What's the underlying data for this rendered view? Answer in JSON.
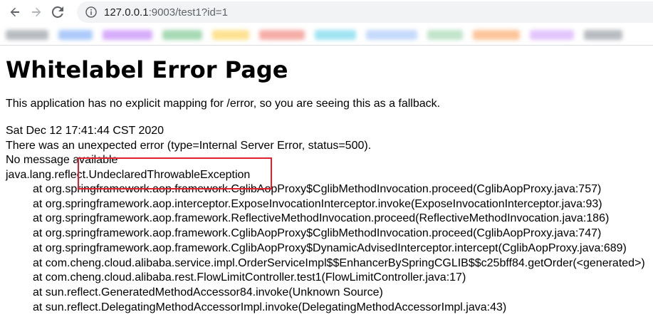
{
  "browser": {
    "url_host": "127.0.0.1",
    "url_rest": ":9003/test1?id=1",
    "icons": [
      "back-arrow-icon",
      "forward-arrow-icon",
      "reload-icon",
      "info-icon"
    ]
  },
  "bookmarks_colors": [
    "#9aa0a6",
    "#8ab4f8",
    "#c58af9",
    "#81c995",
    "#fdd663",
    "#f28b82",
    "#78d9ec",
    "#aecbfa",
    "#a8dab5",
    "#fcad70",
    "#d7aefb",
    "#9aa0a6"
  ],
  "page": {
    "title": "Whitelabel Error Page",
    "message": "This application has no explicit mapping for /error, so you are seeing this as a fallback.",
    "timestamp": "Sat Dec 12 17:41:44 CST 2020",
    "error_line": "There was an unexpected error (type=Internal Server Error, status=500).",
    "no_message": "No message available",
    "exception": "java.lang.reflect.UndeclaredThrowableException",
    "stack": [
      "at org.springframework.aop.framework.CglibAopProxy$CglibMethodInvocation.proceed(CglibAopProxy.java:757)",
      "at org.springframework.aop.interceptor.ExposeInvocationInterceptor.invoke(ExposeInvocationInterceptor.java:93)",
      "at org.springframework.aop.framework.ReflectiveMethodInvocation.proceed(ReflectiveMethodInvocation.java:186)",
      "at org.springframework.aop.framework.CglibAopProxy$CglibMethodInvocation.proceed(CglibAopProxy.java:747)",
      "at org.springframework.aop.framework.CglibAopProxy$DynamicAdvisedInterceptor.intercept(CglibAopProxy.java:689)",
      "at com.cheng.cloud.alibaba.service.impl.OrderServiceImpl$$EnhancerBySpringCGLIB$$c25bff84.getOrder(<generated>)",
      "at com.cheng.cloud.alibaba.rest.FlowLimitController.test1(FlowLimitController.java:17)",
      "at sun.reflect.GeneratedMethodAccessor84.invoke(Unknown Source)",
      "at sun.reflect.DelegatingMethodAccessorImpl.invoke(DelegatingMethodAccessorImpl.java:43)"
    ]
  },
  "highlight_color": "#e0202a"
}
